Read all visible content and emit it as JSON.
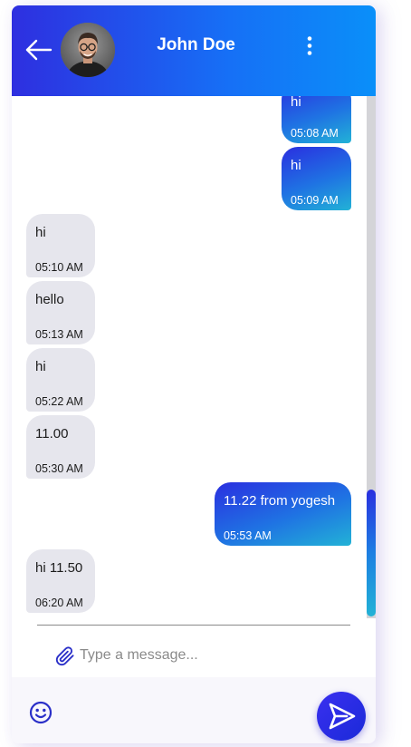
{
  "header": {
    "contact_name": "John Doe",
    "back_icon": "arrow-left-icon",
    "menu_icon": "more-vertical-icon"
  },
  "messages": [
    {
      "direction": "sent",
      "text": "hi",
      "time": "05:08 AM"
    },
    {
      "direction": "sent",
      "text": "hi",
      "time": "05:09 AM"
    },
    {
      "direction": "received",
      "text": "hi",
      "time": "05:10 AM"
    },
    {
      "direction": "received",
      "text": "hello",
      "time": "05:13 AM"
    },
    {
      "direction": "received",
      "text": "hi",
      "time": "05:22 AM"
    },
    {
      "direction": "received",
      "text": "11.00",
      "time": "05:30 AM"
    },
    {
      "direction": "sent",
      "text": "11.22 from yogesh",
      "time": "05:53 AM"
    },
    {
      "direction": "received",
      "text": "hi 11.50",
      "time": "06:20 AM"
    }
  ],
  "composer": {
    "placeholder": "Type a message...",
    "value": "",
    "attach_icon": "paperclip-icon",
    "emoji_icon": "smiley-icon",
    "send_icon": "send-icon"
  },
  "colors": {
    "header_start": "#2e2fe0",
    "header_end": "#0a8ff9",
    "sent_bubble_start": "#2a2fe0",
    "sent_bubble_end": "#22b2d6",
    "received_bubble": "#e6e6ed",
    "send_button": "#2a2ad8"
  }
}
